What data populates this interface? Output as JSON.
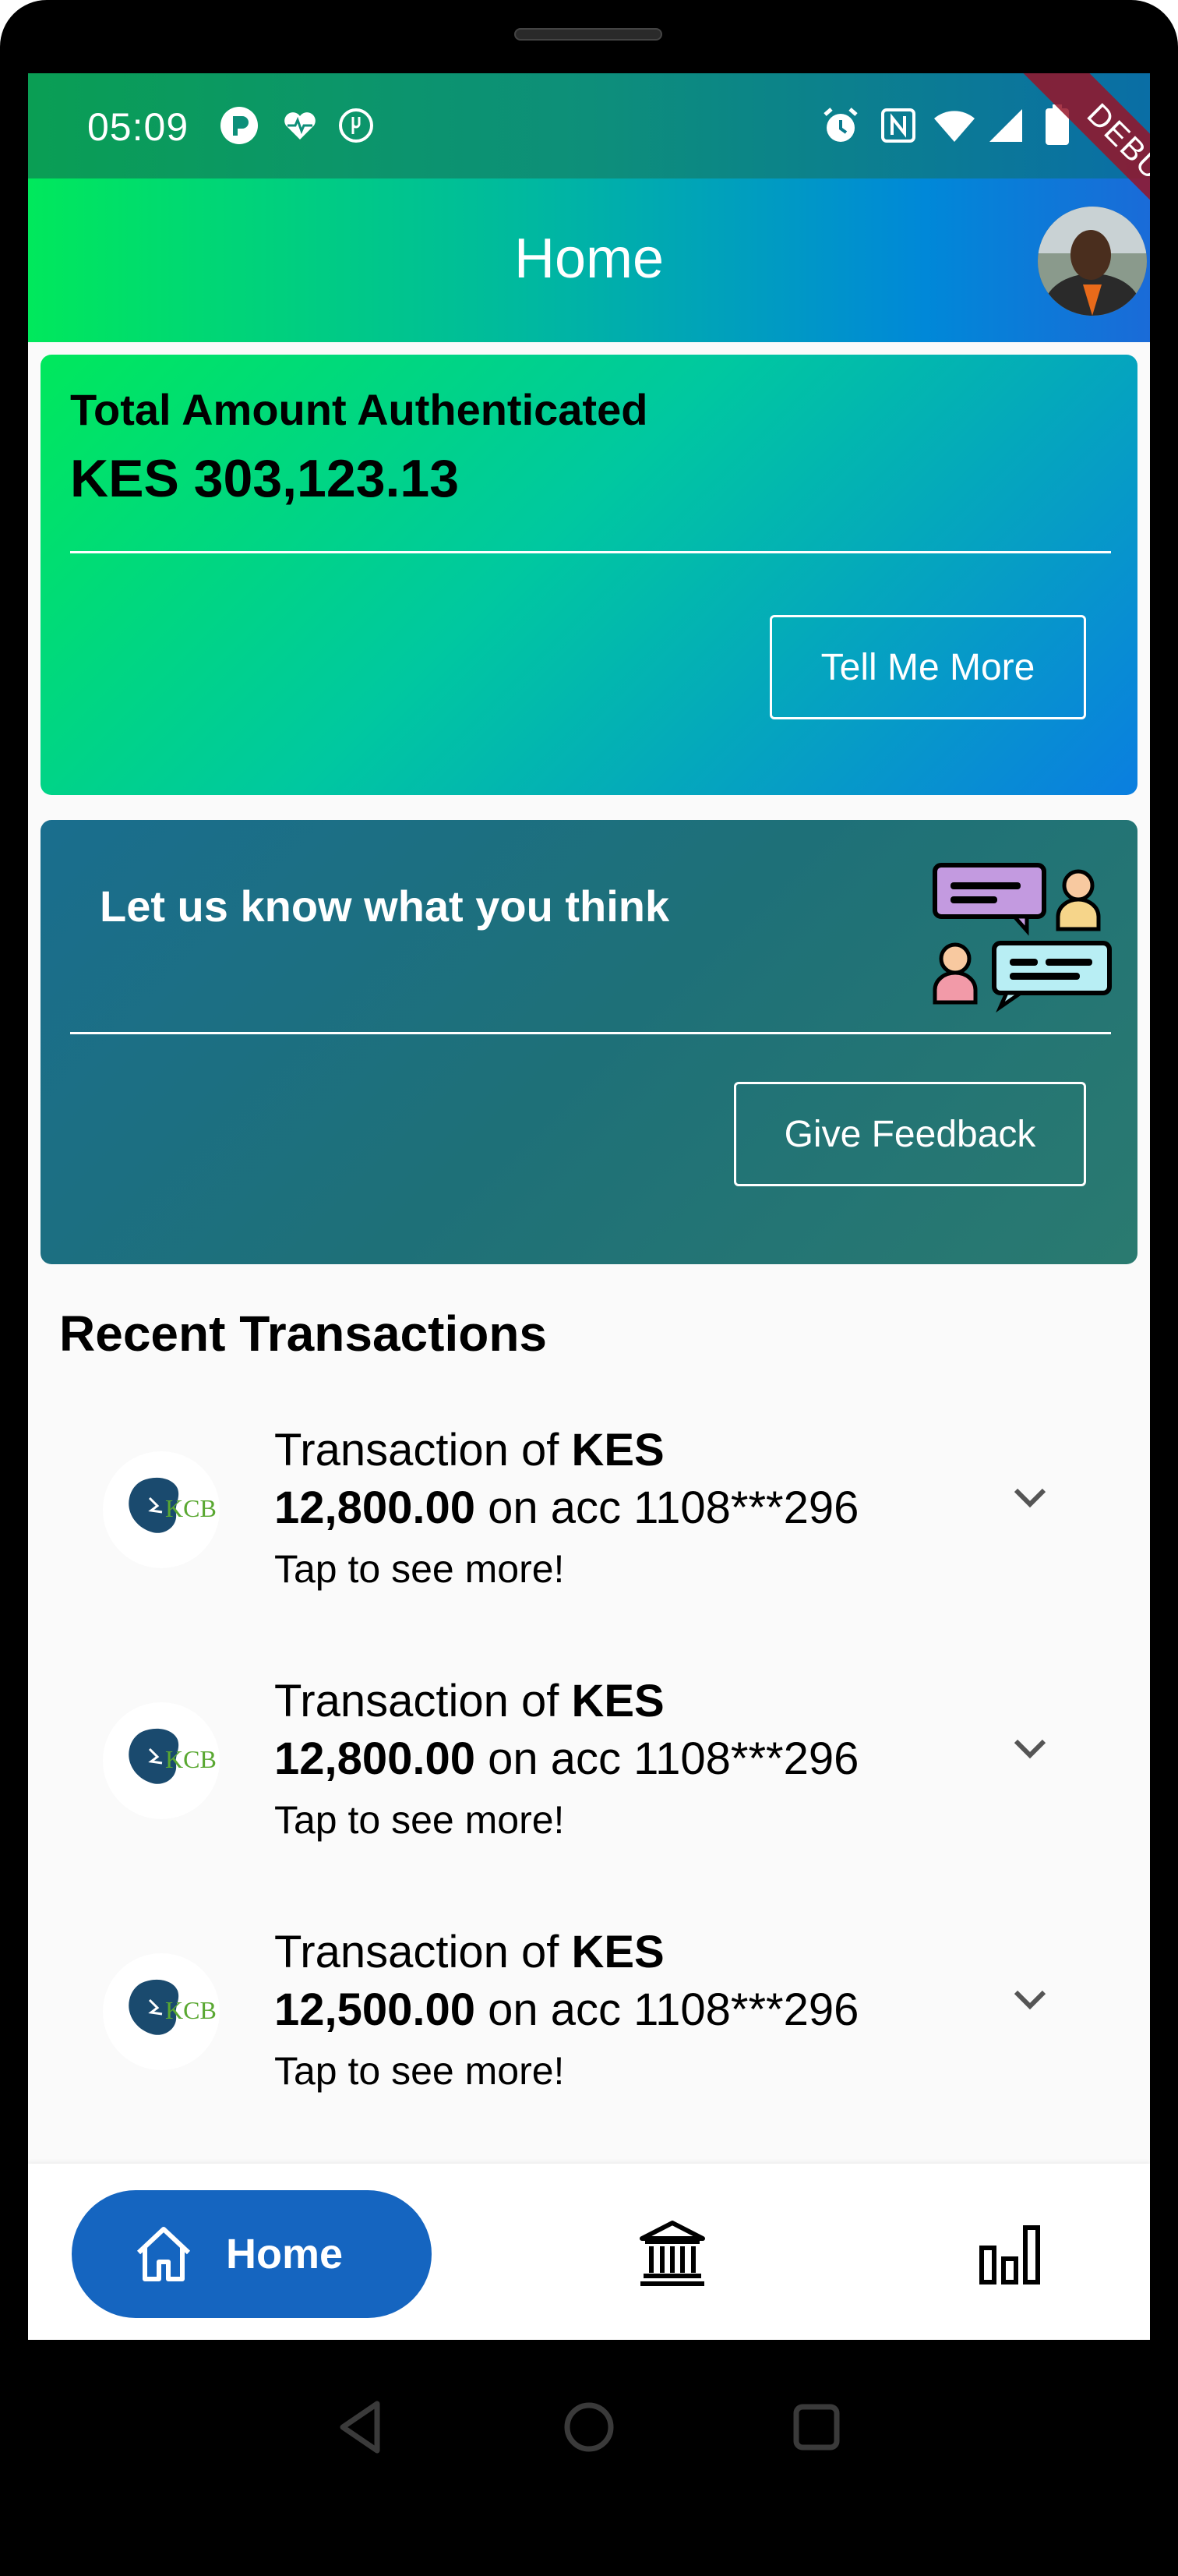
{
  "status_bar": {
    "time": "05:09",
    "left_icons": [
      "pocket-app-icon",
      "health-icon",
      "food-icon"
    ],
    "right_icons": [
      "alarm-icon",
      "nfc-icon",
      "wifi-icon",
      "cell-signal-icon",
      "battery-icon"
    ]
  },
  "app_bar": {
    "title": "Home",
    "debug_banner": "DEBUG"
  },
  "summary_card": {
    "title": "Total Amount Authenticated",
    "amount": "KES 303,123.13",
    "button": "Tell Me More"
  },
  "feedback_card": {
    "title": "Let us know what you think",
    "button": "Give Feedback",
    "illustration": "chat-people-icon"
  },
  "recent": {
    "title": "Recent Transactions",
    "items": [
      {
        "prefix": "Transaction of ",
        "currency": "KES",
        "amount": "12,800.00",
        "suffix": " on acc 1108***296",
        "hint": "Tap to see more!",
        "logo_text": "KCB"
      },
      {
        "prefix": "Transaction of ",
        "currency": "KES",
        "amount": "12,800.00",
        "suffix": " on acc 1108***296",
        "hint": "Tap to see more!",
        "logo_text": "KCB"
      },
      {
        "prefix": "Transaction of ",
        "currency": "KES",
        "amount": "12,500.00",
        "suffix": " on acc 1108***296",
        "hint": "Tap to see more!",
        "logo_text": "KCB"
      }
    ]
  },
  "bottom_nav": {
    "home_label": "Home",
    "icons": [
      "home-icon",
      "bank-icon",
      "bar-chart-icon"
    ],
    "active_color": "#1565c0"
  },
  "colors": {
    "gradient_green": "#00e85c",
    "gradient_blue": "#0a7ee0",
    "feedback_teal": "#1e7078",
    "kcb_navy": "#1a4a6e",
    "kcb_green": "#5aa832"
  }
}
